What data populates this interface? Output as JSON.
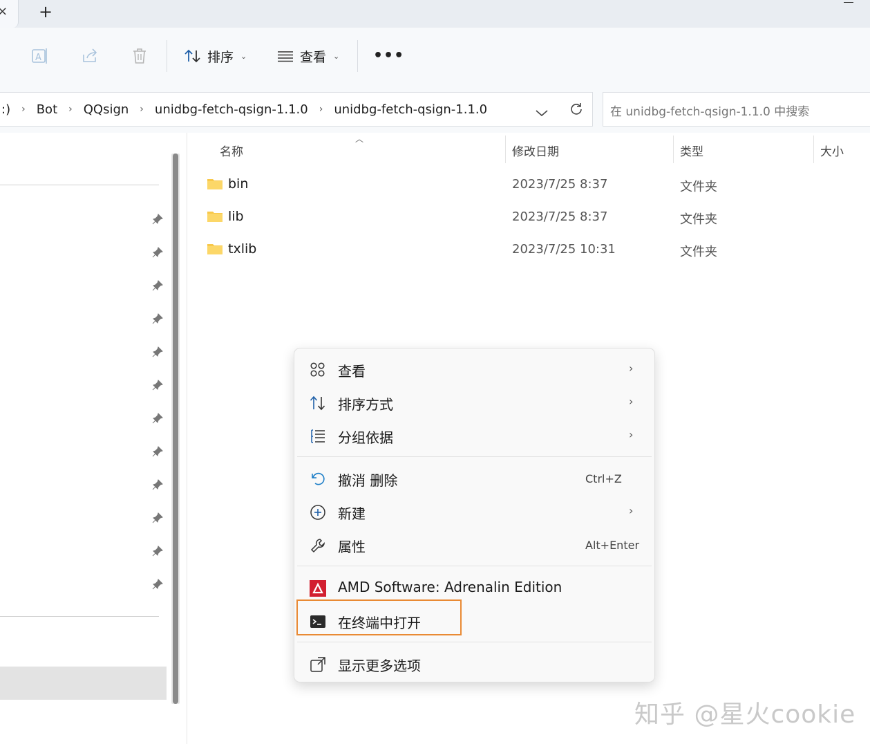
{
  "tabstrip": {
    "new_tab": "+"
  },
  "toolbar": {
    "sort_label": "排序",
    "view_label": "查看",
    "more": "•••"
  },
  "address": {
    "crumbs": [
      ":)",
      "Bot",
      "QQsign",
      "unidbg-fetch-qsign-1.1.0",
      "unidbg-fetch-qsign-1.1.0"
    ],
    "search_placeholder": "在 unidbg-fetch-qsign-1.1.0 中搜索"
  },
  "columns": {
    "name": "名称",
    "date": "修改日期",
    "type": "类型",
    "size": "大小"
  },
  "files": [
    {
      "name": "bin",
      "date": "2023/7/25 8:37",
      "type": "文件夹"
    },
    {
      "name": "lib",
      "date": "2023/7/25 8:37",
      "type": "文件夹"
    },
    {
      "name": "txlib",
      "date": "2023/7/25 10:31",
      "type": "文件夹"
    }
  ],
  "context_menu": {
    "view": "查看",
    "sort_by": "排序方式",
    "group_by": "分组依据",
    "undo_delete": "撤消 删除",
    "undo_shortcut": "Ctrl+Z",
    "new": "新建",
    "properties": "属性",
    "properties_shortcut": "Alt+Enter",
    "amd": "AMD Software: Adrenalin Edition",
    "open_terminal": "在终端中打开",
    "more_options": "显示更多选项"
  },
  "watermark": "知乎 @星火cookie",
  "colors": {
    "accent": "#0067c0",
    "highlight_box": "#e98a34",
    "folder": "#f8c84a",
    "amd_red": "#d21f30"
  }
}
